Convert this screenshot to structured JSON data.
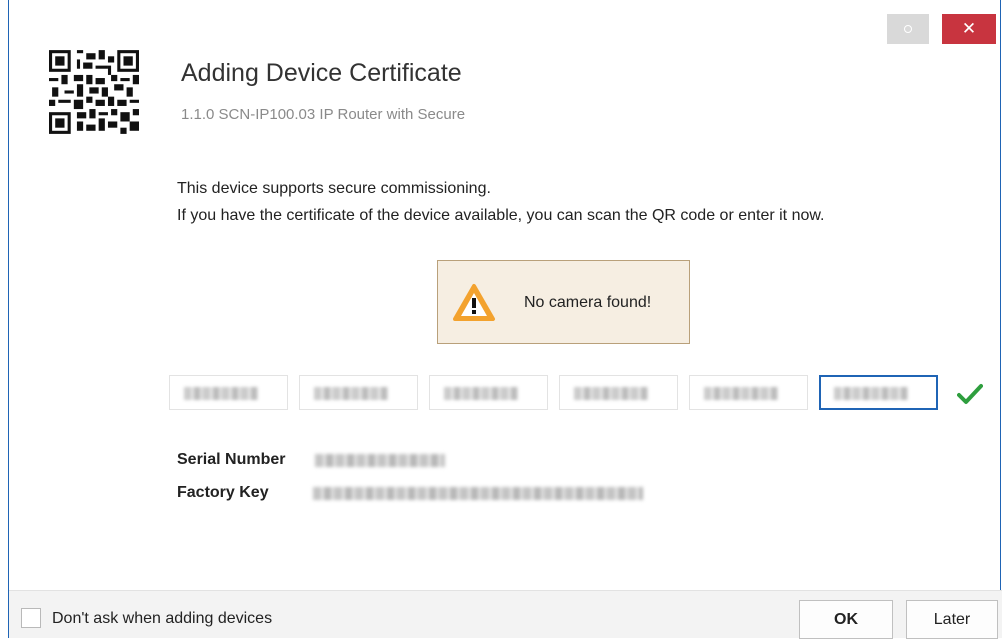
{
  "window": {
    "restore_icon": "circle-icon",
    "close_glyph": "✕"
  },
  "header": {
    "title": "Adding Device Certificate",
    "subtitle": "1.1.0 SCN-IP100.03 IP Router with Secure",
    "qr_icon": "qr-code-icon"
  },
  "intro": {
    "line1": "This device supports secure commissioning.",
    "line2": "If you have the certificate of the device available, you can scan the QR code or enter it now."
  },
  "warning": {
    "icon": "warning-icon",
    "text": "No camera found!",
    "background": "#f6eee2",
    "icon_color": "#f3a22e"
  },
  "certificate": {
    "fields": [
      "",
      "",
      "",
      "",
      "",
      ""
    ],
    "active_field": 6,
    "valid_icon": "checkmark-icon",
    "valid_color": "#2e9e3e"
  },
  "details": {
    "serial_label": "Serial Number",
    "factory_key_label": "Factory Key"
  },
  "footer": {
    "checkbox_label": "Don't ask when adding devices",
    "checkbox_checked": false,
    "ok_label": "OK",
    "later_label": "Later"
  },
  "colors": {
    "accent": "#1f64b5",
    "close_button": "#c8343f"
  }
}
